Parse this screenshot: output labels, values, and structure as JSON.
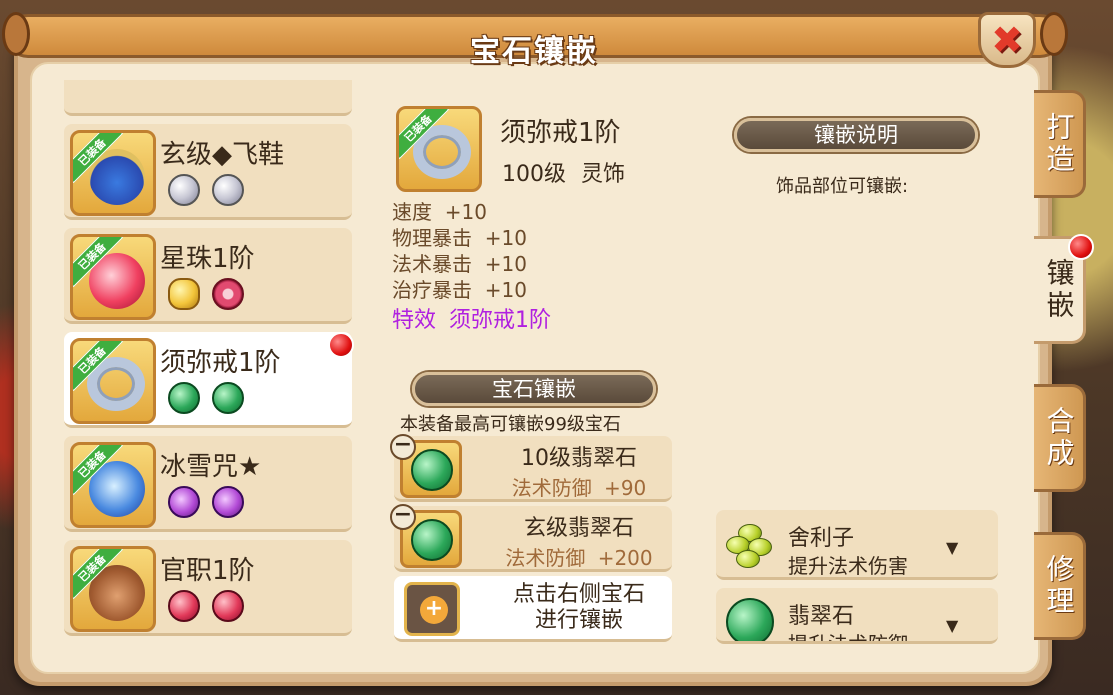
{
  "window": {
    "title": "宝石镶嵌"
  },
  "equipment_list": [
    {
      "name": "玄级◆飞鞋",
      "badge": "已装备",
      "gems": [
        "diamond",
        "diamond"
      ],
      "selected": false,
      "has_alert": false
    },
    {
      "name": "星珠1阶",
      "badge": "已装备",
      "gems": [
        "gold",
        "redring"
      ],
      "selected": false,
      "has_alert": false
    },
    {
      "name": "须弥戒1阶",
      "badge": "已装备",
      "gems": [
        "green",
        "green"
      ],
      "selected": true,
      "has_alert": true
    },
    {
      "name": "冰雪咒★",
      "badge": "已装备",
      "gems": [
        "purple",
        "purple"
      ],
      "selected": false,
      "has_alert": false
    },
    {
      "name": "官职1阶",
      "badge": "已装备",
      "gems": [
        "red",
        "red"
      ],
      "selected": false,
      "has_alert": false
    }
  ],
  "detail": {
    "badge": "已装备",
    "name": "须弥戒1阶",
    "level_type": "100级  灵饰",
    "stats": [
      {
        "label": "速度",
        "value": "+10"
      },
      {
        "label": "物理暴击",
        "value": "+10"
      },
      {
        "label": "法术暴击",
        "value": "+10"
      },
      {
        "label": "治疗暴击",
        "value": "+10"
      }
    ],
    "effect": "特效  须弥戒1阶"
  },
  "gem_section": {
    "title": "宝石镶嵌",
    "hint": "本装备最高可镶嵌99级宝石",
    "slots": [
      {
        "name": "10级翡翠石",
        "attr": "法术防御  +90"
      },
      {
        "name": "玄级翡翠石",
        "attr": "法术防御  +200"
      }
    ],
    "add_slot": {
      "line1": "点击右侧宝石",
      "line2": "进行镶嵌"
    }
  },
  "explain": {
    "title": "镶嵌说明",
    "note": "饰品部位可镶嵌:",
    "options": [
      {
        "name": "舍利子",
        "desc": "提升法术伤害",
        "arrow": "▼"
      },
      {
        "name": "翡翠石",
        "desc": "提升法术防御",
        "arrow": "▼"
      }
    ]
  },
  "tabs": [
    {
      "label": "打造",
      "active": false
    },
    {
      "label": "镶嵌",
      "active": true
    },
    {
      "label": "合成",
      "active": false
    },
    {
      "label": "修理",
      "active": false
    }
  ],
  "close_label": "✖",
  "colors": {
    "accent": "#e3a83c",
    "effect": "#b020e0",
    "alert": "#e01010"
  }
}
